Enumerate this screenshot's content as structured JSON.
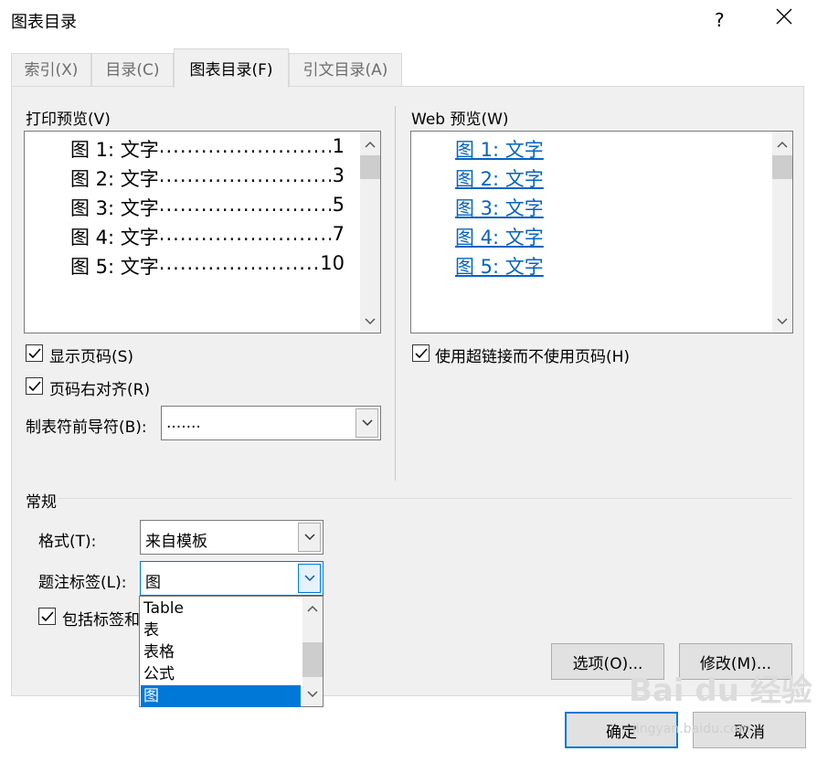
{
  "window": {
    "title": "图表目录",
    "help": "?"
  },
  "tabs": [
    {
      "label": "索引(X)",
      "active": false
    },
    {
      "label": "目录(C)",
      "active": false
    },
    {
      "label": "图表目录(F)",
      "active": true
    },
    {
      "label": "引文目录(A)",
      "active": false
    }
  ],
  "print_preview": {
    "label": "打印预览(V)",
    "lines": [
      {
        "text": "图  1:  文字",
        "page": "1"
      },
      {
        "text": "图  2:  文字",
        "page": "3"
      },
      {
        "text": "图  3:  文字",
        "page": "5"
      },
      {
        "text": "图  4:  文字",
        "page": "7"
      },
      {
        "text": "图  5:  文字",
        "page": "10"
      }
    ],
    "leader": "......................................................."
  },
  "web_preview": {
    "label": "Web 预览(W)",
    "lines": [
      "图  1:  文字",
      "图  2:  文字",
      "图  3:  文字",
      "图  4:  文字",
      "图  5:  文字"
    ]
  },
  "options": {
    "show_page_numbers": {
      "label": "显示页码(S)",
      "checked": true
    },
    "right_align": {
      "label": "页码右对齐(R)",
      "checked": true
    },
    "tab_leader": {
      "label": "制表符前导符(B):",
      "value": "......."
    },
    "use_hyperlinks": {
      "label": "使用超链接而不使用页码(H)",
      "checked": true
    }
  },
  "general": {
    "heading": "常规",
    "format": {
      "label": "格式(T):",
      "value": "来自模板"
    },
    "caption_label": {
      "label": "题注标签(L):",
      "value": "图"
    },
    "include_label": {
      "label": "包括标签和",
      "checked": true
    },
    "dropdown_options": [
      "Table",
      "表",
      "表格",
      "公式",
      "图"
    ],
    "dropdown_selected": "图"
  },
  "buttons": {
    "options": "选项(O)...",
    "modify": "修改(M)...",
    "ok": "确定",
    "cancel": "取消"
  },
  "watermark": {
    "main": "Bai du 经验",
    "sub": "jingyan.baidu.com"
  },
  "colors": {
    "accent": "#0078d7",
    "link": "#0563c1"
  }
}
